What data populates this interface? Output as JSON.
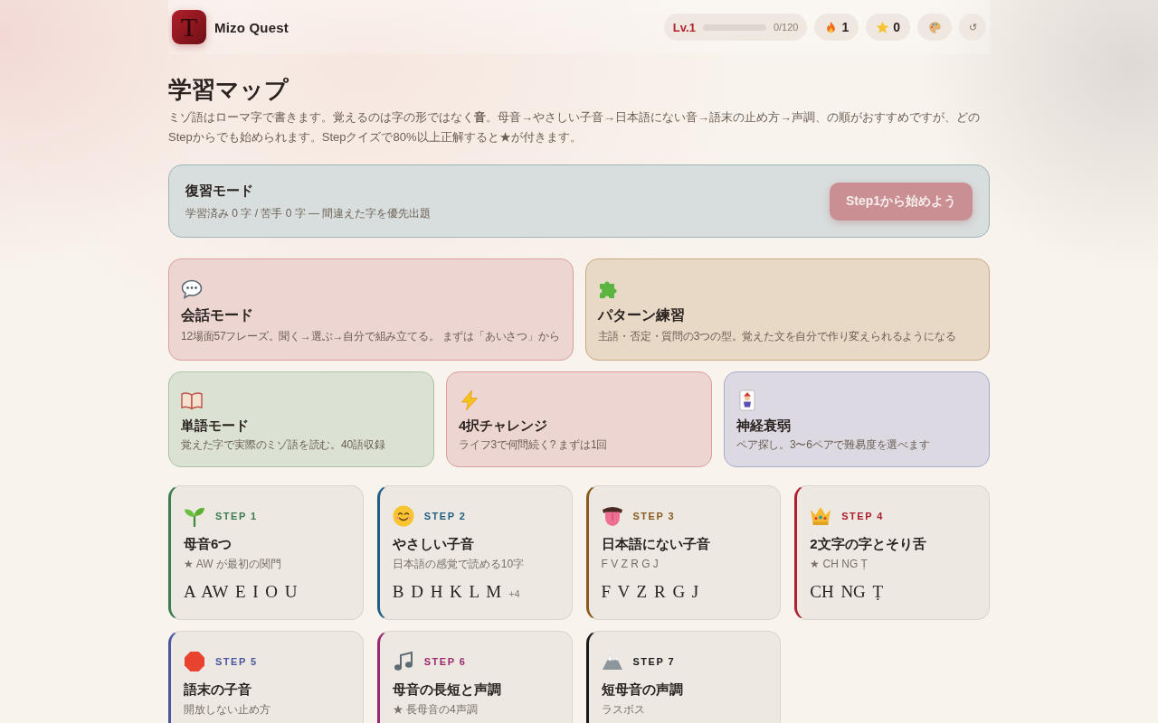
{
  "header": {
    "logo_letter": "T",
    "title": "Mizo Quest",
    "level_badge": {
      "label": "Lv.1",
      "level": 0,
      "reading": "0/120"
    },
    "streak_count": "1",
    "star_count": "0",
    "refresh": "↺"
  },
  "intro": {
    "title": "学習マップ",
    "description": "ミゾ語はローマ字で書きます。覚えるのは字の形ではなく**音**。母音→やさしい子音→日本語にない音→語末の止め方→声調、の順がおすすめですが、どのStepからでも始められます。Stepクイズで80%以上正解すると★が付きます。"
  },
  "review": {
    "title": "復習モード",
    "summary": "学習済み 0 字 / 苦手 0 字 — 間違えた字を優先出題",
    "button": "Step1から始めよう"
  },
  "modes": [
    {
      "kind": "large",
      "title": "会話モード",
      "description": "12場面57フレーズ。聞く→選ぶ→自分で組み立てる。 まずは「あいさつ」から",
      "color": "#d99fa0"
    },
    {
      "kind": "large",
      "title": "パターン練習",
      "description": "主語・否定・質問の3つの型。覚えた文を自分で作り変えられるようになる",
      "color": "#caa982"
    },
    {
      "kind": "small",
      "title": "単語モード",
      "description": "覚えた字で実際のミゾ語を読む。40語収録",
      "color": "#a9c3a4"
    },
    {
      "kind": "small",
      "title": "4択チャレンジ",
      "description": "ライフ3で何問続く? まずは1回",
      "color": "#d99fa0"
    },
    {
      "kind": "small",
      "title": "神経衰弱",
      "description": "ペア探し。3〜6ペアで難易度を選べます",
      "color": "#aaaacf"
    }
  ],
  "steps": [
    {
      "label": "STEP 1",
      "title": "母音6つ",
      "subtitle": "★ AW が最初の関門",
      "letters": "A AW E I O U",
      "color": "#3b7d50"
    },
    {
      "label": "STEP 2",
      "title": "やさしい子音",
      "subtitle": "日本語の感覚で読める10字",
      "letters": "B D H K L M",
      "more": "+4",
      "color": "#1f5f86"
    },
    {
      "label": "STEP 3",
      "title": "日本語にない子音",
      "subtitle": "F V Z R G J",
      "letters": "F V Z R G J",
      "color": "#8a5a1e"
    },
    {
      "label": "STEP 4",
      "title": "2文字の字とそり舌",
      "subtitle": "★ CH NG Ṭ",
      "letters": "CH NG Ṭ",
      "color": "#b0202e"
    },
    {
      "label": "STEP 5",
      "title": "語末の子音",
      "subtitle": "開放しない止め方",
      "color": "#4b56a0"
    },
    {
      "label": "STEP 6",
      "title": "母音の長短と声調",
      "subtitle": "★ 長母音の4声調",
      "color": "#9a2a6e"
    },
    {
      "label": "STEP 7",
      "title": "短母音の声調",
      "subtitle": "ラスボス",
      "color": "#1a1a1a"
    }
  ]
}
